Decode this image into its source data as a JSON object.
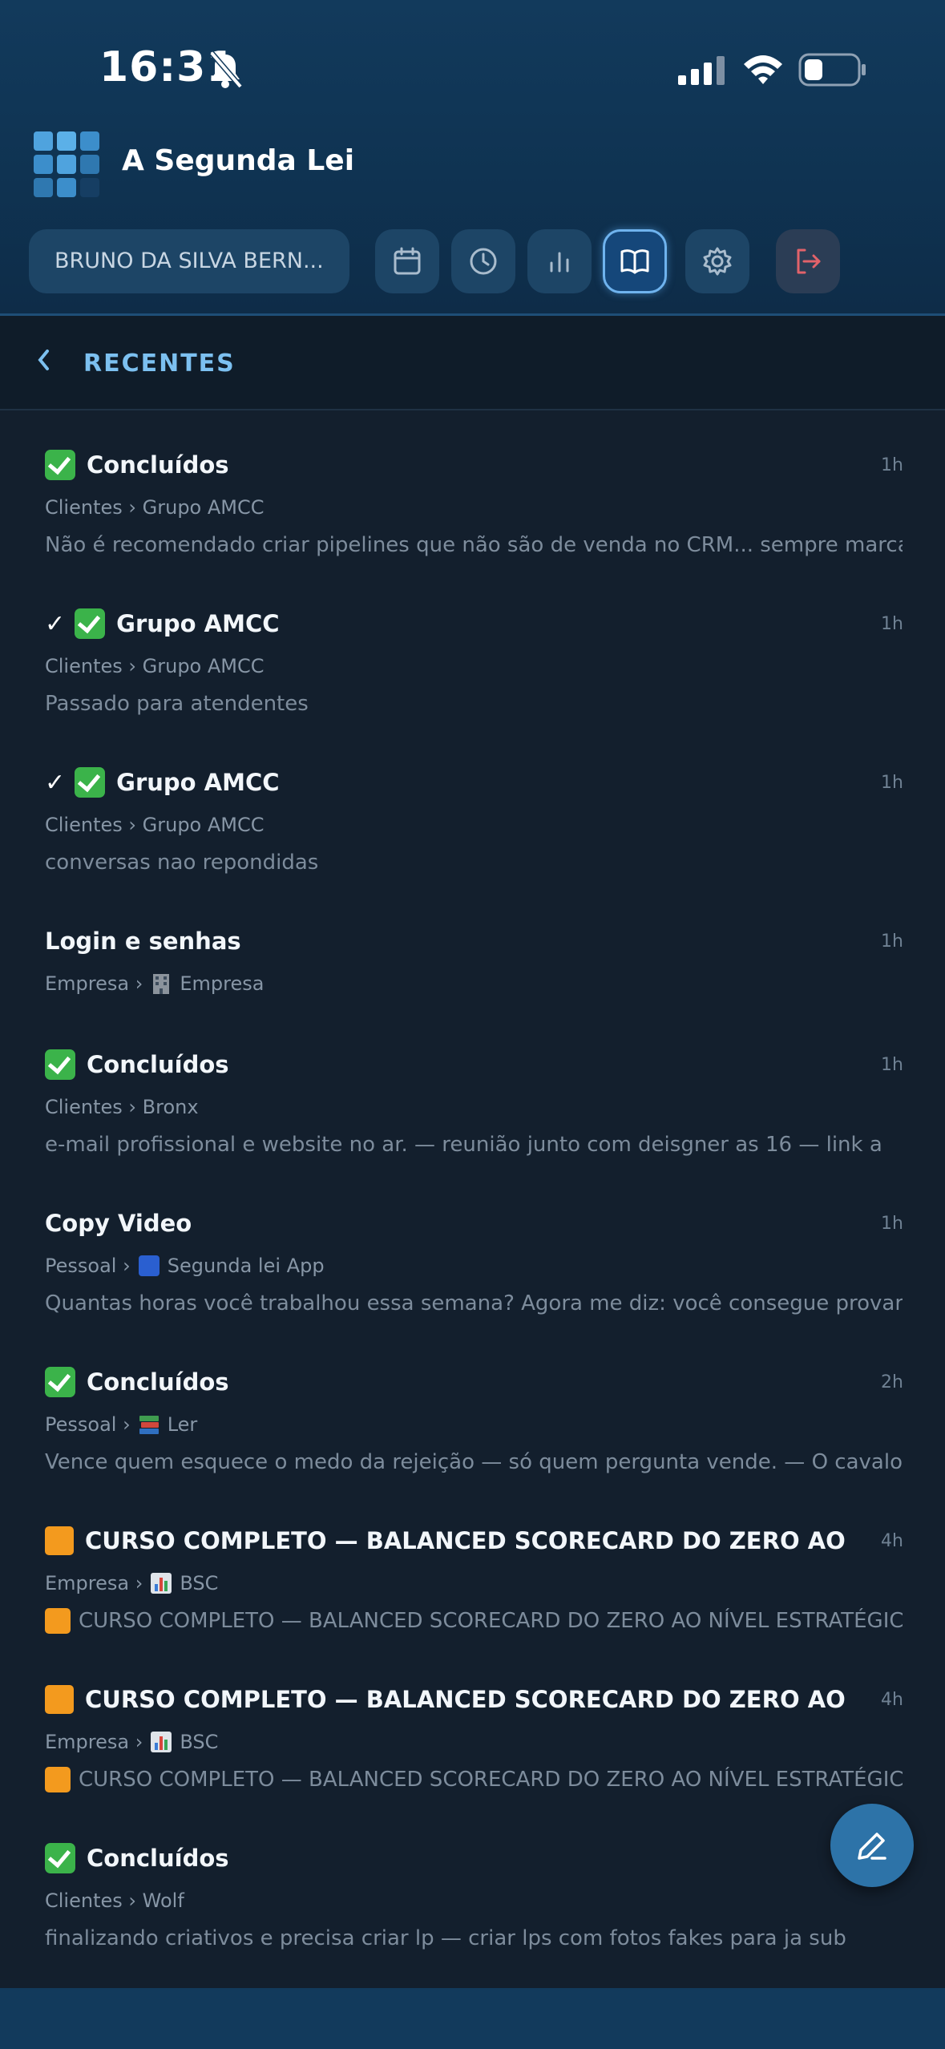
{
  "status_bar": {
    "time": "16:31"
  },
  "app": {
    "title": "A Segunda Lei"
  },
  "toolbar": {
    "user_name": "BRUNO DA SILVA BERN...",
    "buttons": [
      {
        "icon": "calendar-icon"
      },
      {
        "icon": "clock-icon"
      },
      {
        "icon": "bar-chart-icon"
      },
      {
        "icon": "book-open-icon",
        "active": true
      },
      {
        "icon": "gear-icon"
      },
      {
        "icon": "logout-icon"
      }
    ]
  },
  "section": {
    "title": "RECENTES"
  },
  "colors": {
    "accent": "#7cc0f0",
    "check": "#3bb34a",
    "orange": "#f39a1e",
    "logout": "#e2626a",
    "fab": "#2d73a8"
  },
  "items": [
    {
      "title": "Concluídos",
      "time": "1h",
      "path_root": "Clientes",
      "path_leaf": "Grupo AMCC",
      "preview": "Não é recomendado criar pipelines que não são de venda no CRM... sempre marcar ..."
    },
    {
      "tick": "✓",
      "title": "Grupo AMCC",
      "time": "1h",
      "path_root": "Clientes",
      "path_leaf": "Grupo AMCC",
      "preview": "Passado para atendentes"
    },
    {
      "tick": "✓",
      "title": "Grupo AMCC",
      "time": "1h",
      "path_root": "Clientes",
      "path_leaf": "Grupo AMCC",
      "preview": "conversas nao repondidas"
    },
    {
      "title": "Login e senhas",
      "time": "1h",
      "path_root": "Empresa",
      "path_leaf": "Empresa",
      "path_icon": "office-building-icon"
    },
    {
      "title": "Concluídos",
      "time": "1h",
      "path_root": "Clientes",
      "path_leaf": "Bronx",
      "preview": "e-mail profissional e website no ar. — reunião junto com deisgner as 16 — link a"
    },
    {
      "title": "Copy Video",
      "time": "1h",
      "path_root": "Pessoal",
      "path_leaf": "Segunda lei App",
      "path_icon": "blue-square-icon",
      "preview": "Quantas horas você trabalhou essa semana? Agora me diz: você consegue provar q..."
    },
    {
      "title": "Concluídos",
      "time": "2h",
      "path_root": "Pessoal",
      "path_leaf": "Ler",
      "path_icon": "books-icon",
      "preview": "Vence quem esquece o medo da rejeição — só quem pergunta vende. — O cavalo s..."
    },
    {
      "title": "CURSO COMPLETO — BALANCED SCORECARD DO ZERO AO NÍVEL ES...",
      "time": "4h",
      "path_root": "Empresa",
      "path_leaf": "BSC",
      "path_icon": "bar-chart-emoji-icon",
      "preview": "CURSO COMPLETO — BALANCED SCORECARD DO ZERO AO NÍVEL ESTRATÉGIC..."
    },
    {
      "title": "CURSO COMPLETO — BALANCED SCORECARD DO ZERO AO NÍVEL ES...",
      "time": "4h",
      "path_root": "Empresa",
      "path_leaf": "BSC",
      "path_icon": "bar-chart-emoji-icon",
      "preview": "CURSO COMPLETO — BALANCED SCORECARD DO ZERO AO NÍVEL ESTRATÉGIC..."
    },
    {
      "title": "Concluídos",
      "time": "",
      "path_root": "Clientes",
      "path_leaf": "Wolf",
      "preview": "finalizando criativos e precisa criar lp — criar lps com fotos fakes para ja sub"
    }
  ],
  "path_separator": "›"
}
